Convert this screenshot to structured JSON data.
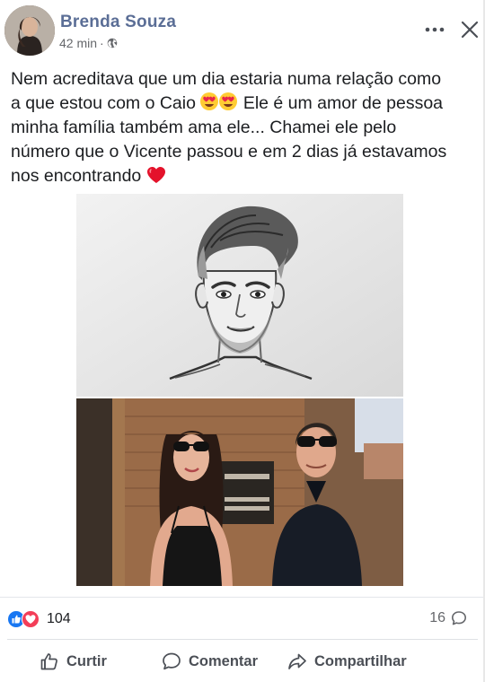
{
  "post": {
    "author": "Brenda Souza",
    "time": "42 min",
    "privacy_icon": "globe-icon",
    "text_lines": [
      "Nem acreditava que um dia estaria numa relação como",
      "a que estou com o Caio",
      "Ele é um amor de pessoa",
      "minha família também ama ele... Chamei ele pelo",
      "número que o Vicente passou e em 2 dias já estavamos",
      "nos encontrando"
    ],
    "emoji": [
      "heart-eyes-emoji",
      "red-heart-emoji"
    ]
  },
  "stats": {
    "reactions": "104",
    "comments": "16",
    "reaction_icons": [
      "like-icon",
      "love-icon"
    ]
  },
  "actions": {
    "like": "Curtir",
    "comment": "Comentar",
    "share": "Compartilhar"
  },
  "colors": {
    "author": "#5b6e96",
    "like_blue": "#1877f2",
    "love_red": "#f33e58"
  }
}
